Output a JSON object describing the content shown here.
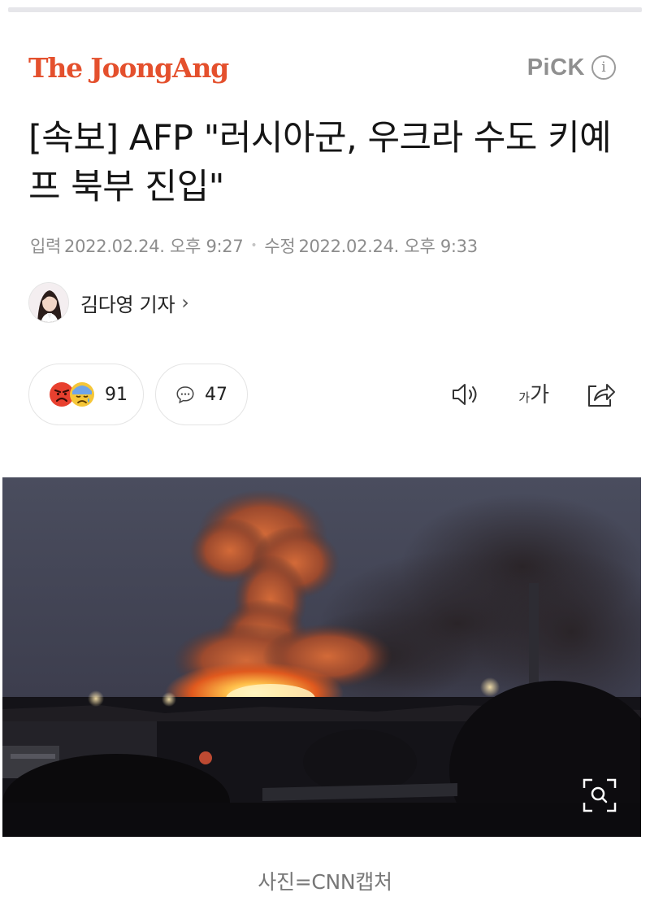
{
  "header": {
    "brand": "The JoongAng",
    "pick_label": "PiCK",
    "info_icon": "info-circle-icon"
  },
  "article": {
    "headline": "[속보] AFP \"러시아군, 우크라 수도 키예프 북부 진입\"",
    "published_label": "입력",
    "published_at": "2022.02.24. 오후 9:27",
    "modified_label": "수정",
    "modified_at": "2022.02.24. 오후 9:33",
    "author": "김다영 기자",
    "author_chevron": "›"
  },
  "actions": {
    "reaction_count": "91",
    "comment_count": "47",
    "fontsize_small": "가",
    "fontsize_large": "가",
    "icons": [
      "angry-face-icon",
      "sad-face-icon",
      "comment-bubble-icon",
      "speaker-icon",
      "font-size-icon",
      "share-icon",
      "zoom-icon"
    ]
  },
  "photo": {
    "caption": "사진=CNN캡처"
  },
  "colors": {
    "brand": "#e4502d",
    "muted": "#8d8d8d"
  }
}
